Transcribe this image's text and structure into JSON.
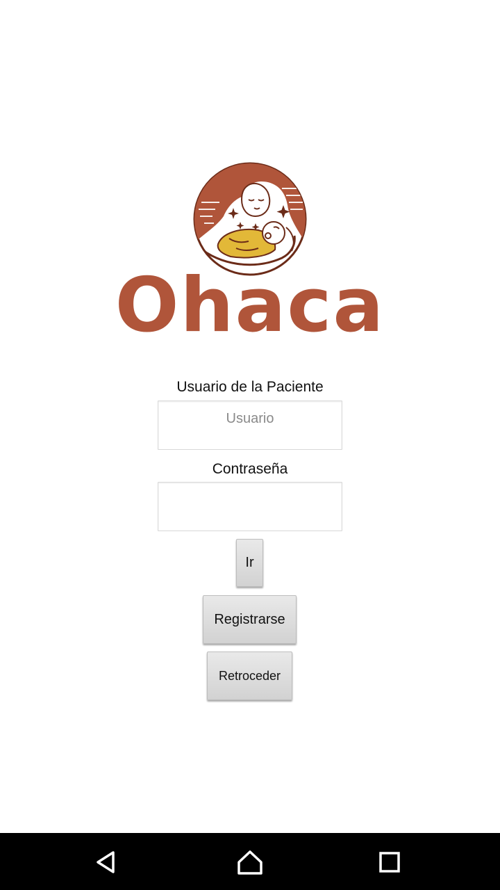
{
  "app": {
    "logo_text": "Ohaca",
    "logo_icon": "mother-and-baby-emblem",
    "brand_color": "#b0553a",
    "accent_yellow": "#e2b838"
  },
  "form": {
    "username_label": "Usuario de la Paciente",
    "username_placeholder": "Usuario",
    "username_value": "",
    "password_label": "Contraseña",
    "password_value": ""
  },
  "buttons": {
    "go_label": "Ir",
    "register_label": "Registrarse",
    "back_label": "Retroceder"
  },
  "navbar": {
    "back_icon": "back-triangle-icon",
    "home_icon": "home-icon",
    "recents_icon": "recents-square-icon"
  }
}
